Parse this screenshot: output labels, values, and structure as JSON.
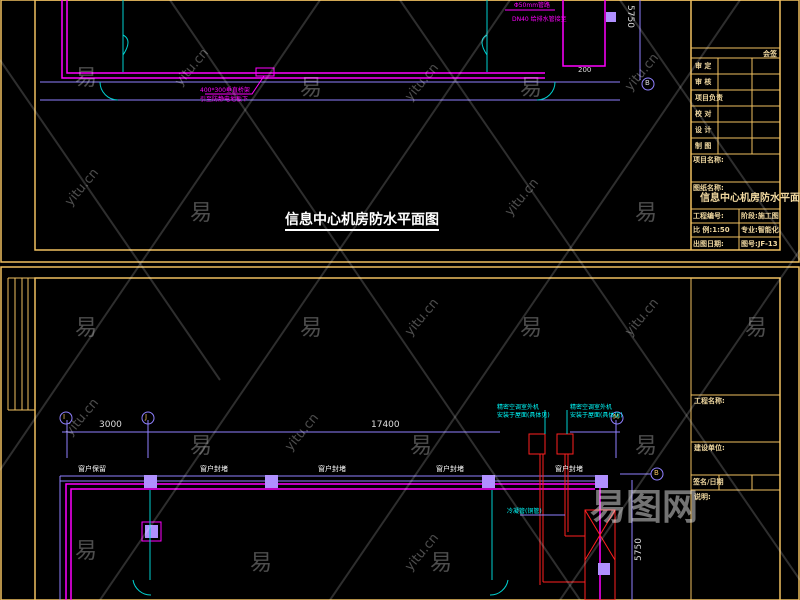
{
  "upper_sheet": {
    "drawing_title": "信息中心机房防水平面图",
    "annotations": {
      "cable_tray_line1": "400*300垂直桥架",
      "cable_tray_line2": "引至防静电地板下",
      "top_note_line1": "Φ50mm管路",
      "top_note_line2": "DN40 给排水管接至",
      "dim_vertical": "5750",
      "dim_small": "200",
      "axis_label": "B"
    },
    "title_block": {
      "header": "会签",
      "rows": [
        "审 定",
        "审 核",
        "项目负责",
        "校 对",
        "设 计",
        "制 图"
      ],
      "project_name_label": "项目名称:",
      "drawing_name_label": "图纸名称:",
      "drawing_name": "信息中心机房防水平面图",
      "project_no_label": "工程编号:",
      "phase_label": "阶段:",
      "phase_value": "施工图",
      "scale_label": "比 例:",
      "scale_value": "1:50",
      "discipline_label": "专业:",
      "discipline_value": "智能化",
      "date_label": "出图日期:",
      "sheet_no_label": "图号:",
      "sheet_no_value": "JF-13"
    }
  },
  "lower_sheet": {
    "axes": [
      "I",
      "J",
      "M",
      "B"
    ],
    "dimensions": {
      "d1": "3000",
      "d2": "17400",
      "d3": "5750"
    },
    "window_labels": [
      "窗户保留",
      "窗户封堵",
      "窗户封堵",
      "窗户封堵",
      "窗户封堵"
    ],
    "outdoor_unit_note1_line1": "精密空调室外机",
    "outdoor_unit_note1_line2": "安装于屋面(具体见)",
    "outdoor_unit_note2_line1": "精密空调室外机",
    "outdoor_unit_note2_line2": "安装于屋面(具体见)",
    "pipe_label": "冷凝管(铜管)",
    "title_block": {
      "project_name_label": "工程名称:",
      "client_label": "建设单位:",
      "sign_date_label": "签名/日期",
      "other_label": "说明:"
    }
  },
  "watermark": {
    "glyph": "易",
    "site": "yitu.cn",
    "logo": "易图网"
  },
  "colors": {
    "frame": "#f0c060",
    "wall": "#ff00ff",
    "dim": "#9080ff",
    "pipe": "#ff2020",
    "door": "#00d0d0"
  }
}
